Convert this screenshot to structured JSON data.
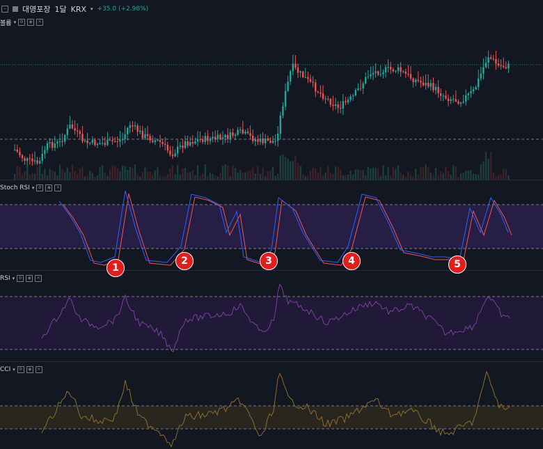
{
  "header": {
    "symbol_name": "대영포장",
    "interval": "1달",
    "exchange": "KRX",
    "change": "+35.0 (+2.98%)"
  },
  "panes": {
    "price": {
      "label": "볼륨"
    },
    "stoch": {
      "label": "Stoch RSI"
    },
    "rsi": {
      "label": "RSI"
    },
    "cci": {
      "label": "CCI"
    }
  },
  "markers": [
    "1",
    "2",
    "3",
    "4",
    "5"
  ],
  "colors": {
    "background": "#131722",
    "up": "#26a69a",
    "down": "#ef5350",
    "stoch_band": "#2a1f4a",
    "rsi_band": "#22193a",
    "cci_band": "#2a2620",
    "k_line": "#2962ff",
    "d_line": "#ef5350",
    "rsi_line": "#7e3fa0",
    "cci_line": "#8d6e2a",
    "marker": "#e01e1e"
  },
  "icons": [
    "collapse-icon",
    "symbol-logo-icon",
    "chevron-down-icon",
    "settings-icon",
    "visibility-icon",
    "close-icon"
  ]
}
